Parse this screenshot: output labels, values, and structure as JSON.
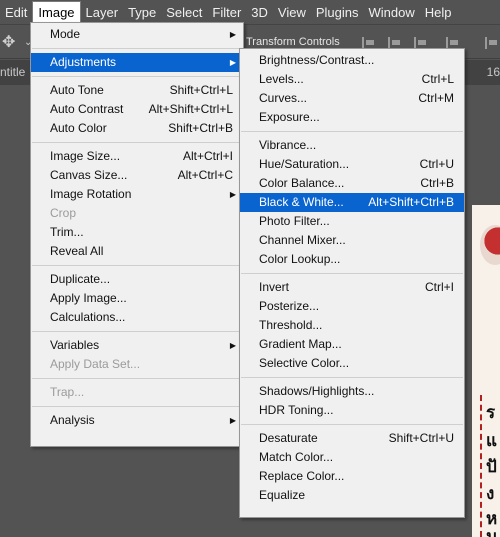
{
  "menubar": [
    "Edit",
    "Image",
    "Layer",
    "Type",
    "Select",
    "Filter",
    "3D",
    "View",
    "Plugins",
    "Window",
    "Help"
  ],
  "optionsbar": {
    "transform_label": "Transform Controls"
  },
  "tabs": {
    "left": "ntitle",
    "right": "16"
  },
  "image_menu": [
    {
      "type": "item",
      "label": "Mode",
      "arrow": "▶"
    },
    {
      "type": "sep"
    },
    {
      "type": "item",
      "label": "Adjustments",
      "arrow": "▶",
      "highlight": true
    },
    {
      "type": "sep"
    },
    {
      "type": "item",
      "label": "Auto Tone",
      "shortcut": "Shift+Ctrl+L"
    },
    {
      "type": "item",
      "label": "Auto Contrast",
      "shortcut": "Alt+Shift+Ctrl+L"
    },
    {
      "type": "item",
      "label": "Auto Color",
      "shortcut": "Shift+Ctrl+B"
    },
    {
      "type": "sep"
    },
    {
      "type": "item",
      "label": "Image Size...",
      "shortcut": "Alt+Ctrl+I"
    },
    {
      "type": "item",
      "label": "Canvas Size...",
      "shortcut": "Alt+Ctrl+C"
    },
    {
      "type": "item",
      "label": "Image Rotation",
      "arrow": "▶"
    },
    {
      "type": "item",
      "label": "Crop",
      "disabled": true
    },
    {
      "type": "item",
      "label": "Trim..."
    },
    {
      "type": "item",
      "label": "Reveal All"
    },
    {
      "type": "sep"
    },
    {
      "type": "item",
      "label": "Duplicate..."
    },
    {
      "type": "item",
      "label": "Apply Image..."
    },
    {
      "type": "item",
      "label": "Calculations..."
    },
    {
      "type": "sep"
    },
    {
      "type": "item",
      "label": "Variables",
      "arrow": "▶"
    },
    {
      "type": "item",
      "label": "Apply Data Set...",
      "disabled": true
    },
    {
      "type": "sep"
    },
    {
      "type": "item",
      "label": "Trap...",
      "disabled": true
    },
    {
      "type": "sep"
    },
    {
      "type": "item",
      "label": "Analysis",
      "arrow": "▶"
    }
  ],
  "adjust_menu": [
    {
      "type": "item",
      "label": "Brightness/Contrast..."
    },
    {
      "type": "item",
      "label": "Levels...",
      "shortcut": "Ctrl+L"
    },
    {
      "type": "item",
      "label": "Curves...",
      "shortcut": "Ctrl+M"
    },
    {
      "type": "item",
      "label": "Exposure..."
    },
    {
      "type": "sep"
    },
    {
      "type": "item",
      "label": "Vibrance..."
    },
    {
      "type": "item",
      "label": "Hue/Saturation...",
      "shortcut": "Ctrl+U"
    },
    {
      "type": "item",
      "label": "Color Balance...",
      "shortcut": "Ctrl+B"
    },
    {
      "type": "item",
      "label": "Black & White...",
      "shortcut": "Alt+Shift+Ctrl+B",
      "highlight": true
    },
    {
      "type": "item",
      "label": "Photo Filter..."
    },
    {
      "type": "item",
      "label": "Channel Mixer..."
    },
    {
      "type": "item",
      "label": "Color Lookup..."
    },
    {
      "type": "sep"
    },
    {
      "type": "item",
      "label": "Invert",
      "shortcut": "Ctrl+I"
    },
    {
      "type": "item",
      "label": "Posterize..."
    },
    {
      "type": "item",
      "label": "Threshold..."
    },
    {
      "type": "item",
      "label": "Gradient Map..."
    },
    {
      "type": "item",
      "label": "Selective Color..."
    },
    {
      "type": "sep"
    },
    {
      "type": "item",
      "label": "Shadows/Highlights..."
    },
    {
      "type": "item",
      "label": "HDR Toning..."
    },
    {
      "type": "sep"
    },
    {
      "type": "item",
      "label": "Desaturate",
      "shortcut": "Shift+Ctrl+U"
    },
    {
      "type": "item",
      "label": "Match Color..."
    },
    {
      "type": "item",
      "label": "Replace Color..."
    },
    {
      "type": "item",
      "label": "Equalize"
    }
  ],
  "doc_text": [
    "ร",
    "แ",
    "ปั",
    "ง",
    "ห",
    "ม"
  ],
  "colors": {
    "highlight": "#0a64cf",
    "chrome": "#535353",
    "menu_bg": "#f0f0f0"
  }
}
